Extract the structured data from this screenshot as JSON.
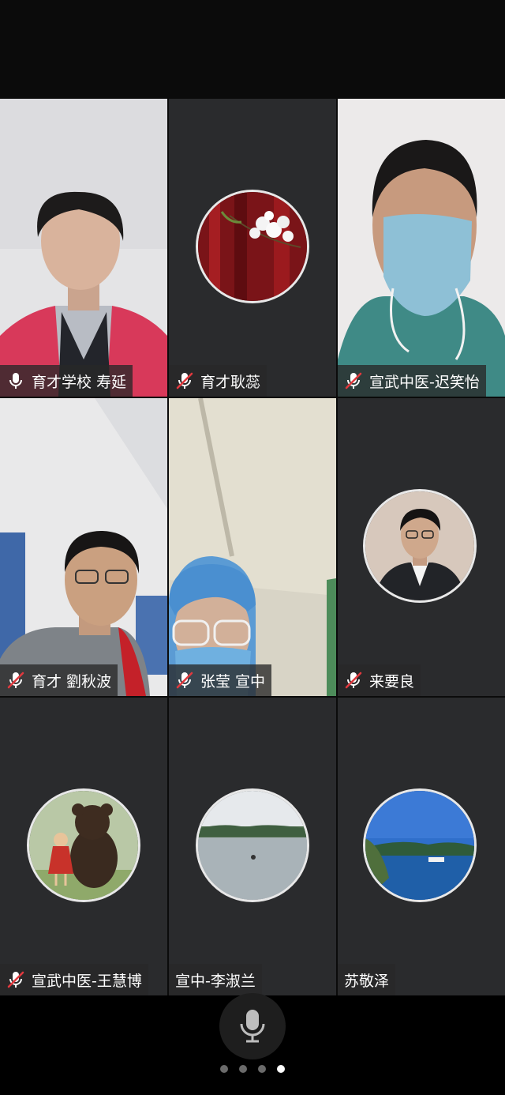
{
  "participants": [
    {
      "name": "育才学校 寿延",
      "muted": false
    },
    {
      "name": "育才耿蕊",
      "muted": true
    },
    {
      "name": "宣武中医-迟笑怡",
      "muted": true
    },
    {
      "name": "育才 劉秋波",
      "muted": true
    },
    {
      "name": "张莹 宣中",
      "muted": true
    },
    {
      "name": "来要良",
      "muted": true
    },
    {
      "name": "宣武中医-王慧博",
      "muted": true
    },
    {
      "name": "宣中-李淑兰",
      "muted": null
    },
    {
      "name": "苏敬泽",
      "muted": null
    }
  ],
  "pager": {
    "pages": 4,
    "active": 4
  },
  "colors": {
    "tile_bg": "#2a2b2d",
    "muted_red": "#e0393e",
    "label_bg": "rgba(40,40,40,0.78)"
  }
}
